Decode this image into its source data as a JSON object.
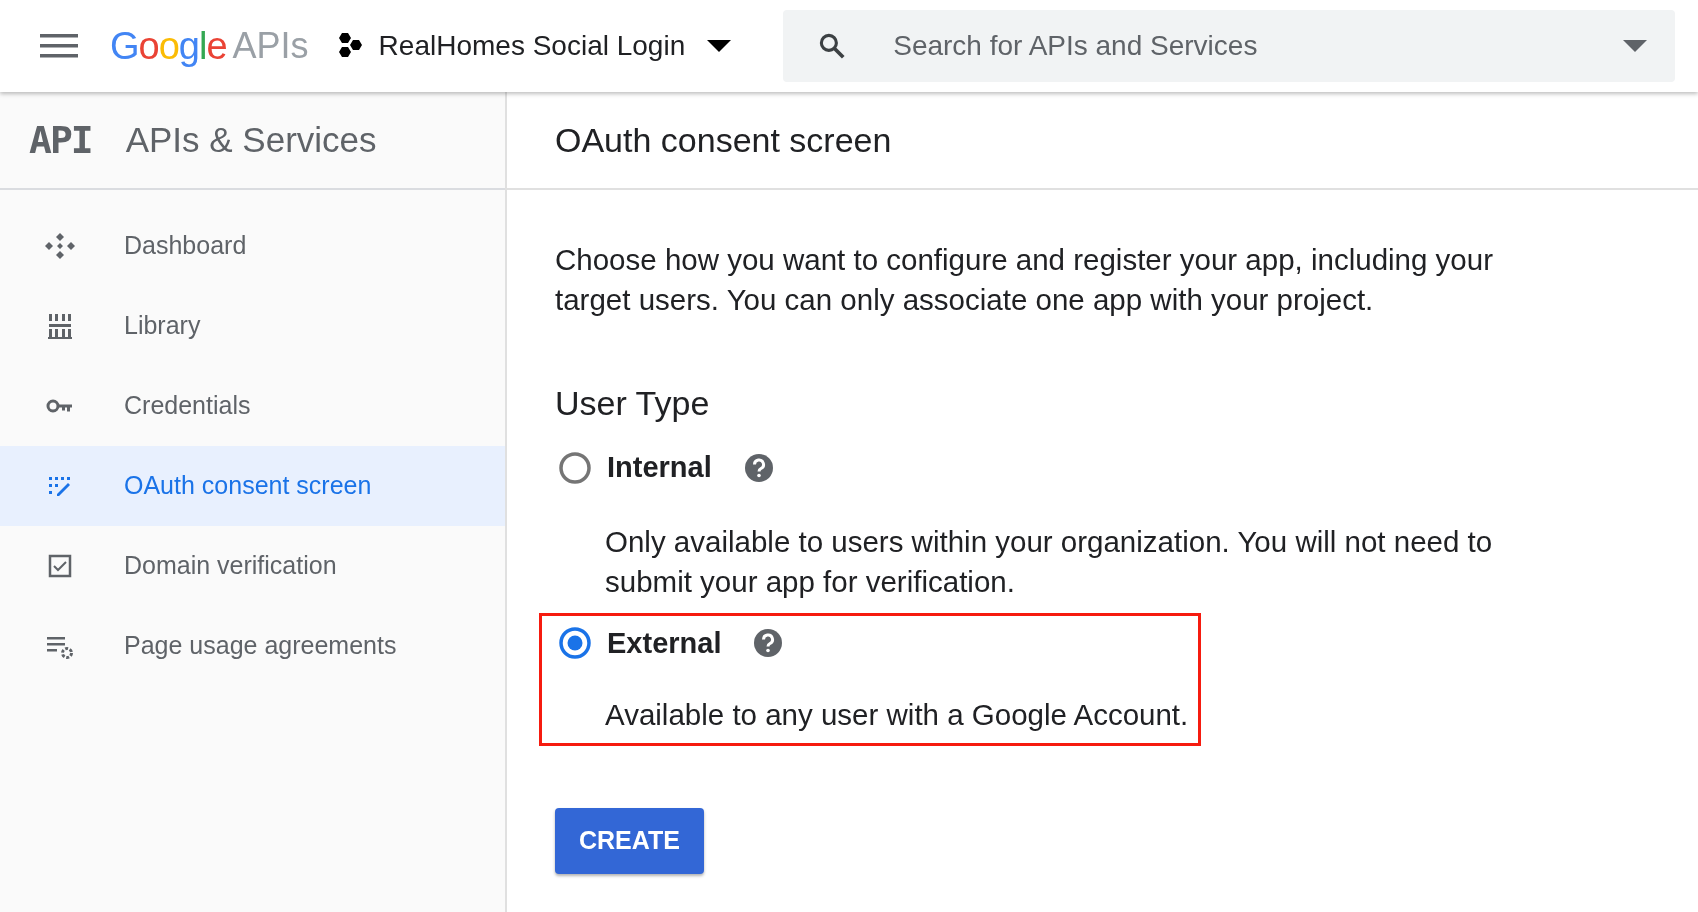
{
  "header": {
    "logo": {
      "wordmark": "Google",
      "product": "APIs"
    },
    "project": "RealHomes Social Login",
    "search": {
      "placeholder": "Search for APIs and Services"
    }
  },
  "sidebar": {
    "badge": "API",
    "title": "APIs & Services",
    "items": [
      {
        "label": "Dashboard",
        "selected": false
      },
      {
        "label": "Library",
        "selected": false
      },
      {
        "label": "Credentials",
        "selected": false
      },
      {
        "label": "OAuth consent screen",
        "selected": true
      },
      {
        "label": "Domain verification",
        "selected": false
      },
      {
        "label": "Page usage agreements",
        "selected": false
      }
    ]
  },
  "main": {
    "title": "OAuth consent screen",
    "intro": "Choose how you want to configure and register your app, including your target users. You can only associate one app with your project.",
    "section_title": "User Type",
    "options": [
      {
        "label": "Internal",
        "description": "Only available to users within your organization. You will not need to submit your app for verification.",
        "selected": false,
        "highlighted": false
      },
      {
        "label": "External",
        "description": "Available to any user with a Google Account.",
        "selected": true,
        "highlighted": true
      }
    ],
    "button": "CREATE"
  }
}
